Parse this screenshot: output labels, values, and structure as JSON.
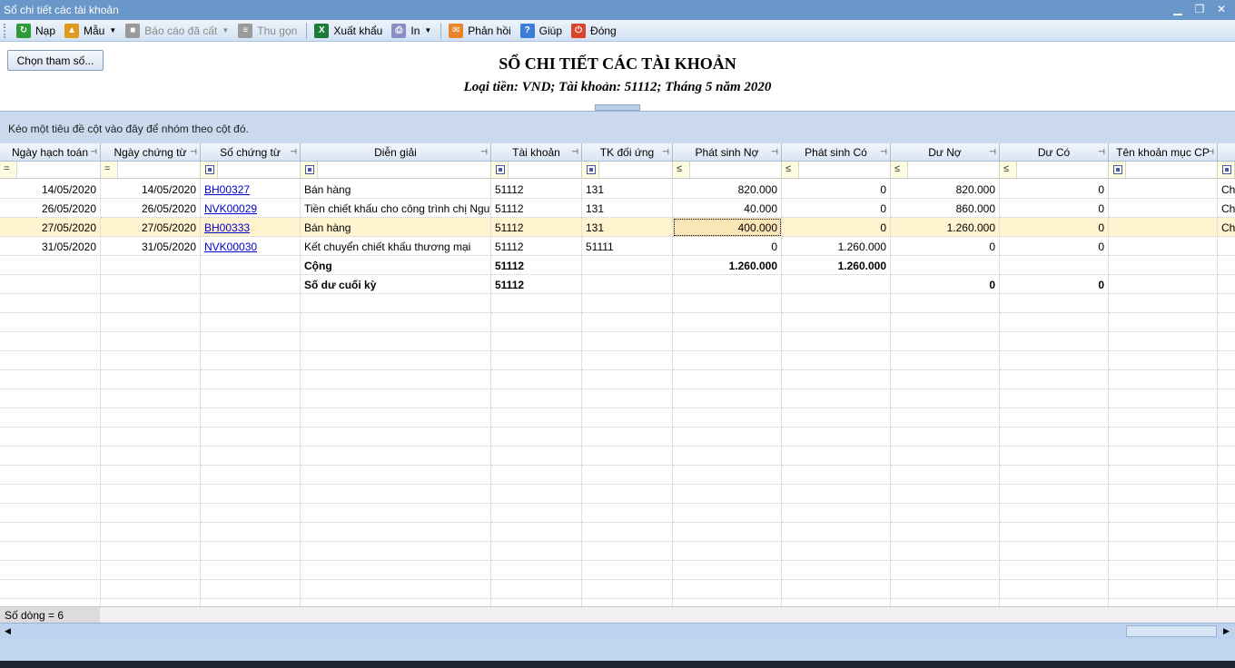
{
  "window": {
    "title": "Sổ chi tiết các tài khoản"
  },
  "toolbar": {
    "items": [
      {
        "label": "Nạp",
        "icon": "refresh-icon",
        "color": "#2e9b3a",
        "enabled": true
      },
      {
        "label": "Mẫu",
        "icon": "chart-icon",
        "color": "#e09a1f",
        "enabled": true,
        "dropdown": true
      },
      {
        "label": "Báo cáo đã cất",
        "icon": "save-icon",
        "color": "#9a9a9a",
        "enabled": false,
        "dropdown": true
      },
      {
        "label": "Thu gọn",
        "icon": "collapse-icon",
        "color": "#9a9a9a",
        "enabled": false
      },
      {
        "label": "Xuất khẩu",
        "icon": "excel-icon",
        "color": "#1e7a3a",
        "enabled": true
      },
      {
        "label": "In",
        "icon": "printer-icon",
        "color": "#8a8fc8",
        "enabled": true,
        "dropdown": true
      },
      {
        "label": "Phản hồi",
        "icon": "mail-icon",
        "color": "#e8842a",
        "enabled": true
      },
      {
        "label": "Giúp",
        "icon": "help-icon",
        "color": "#3b7dd8",
        "enabled": true
      },
      {
        "label": "Đóng",
        "icon": "power-icon",
        "color": "#d9452b",
        "enabled": true
      }
    ]
  },
  "params_button": "Chọn tham số...",
  "report": {
    "title": "SỔ CHI TIẾT CÁC TÀI KHOẢN",
    "subtitle": "Loại tiền: VND; Tài khoản: 51112; Tháng 5 năm 2020"
  },
  "group_hint": "Kéo một tiêu đề cột vào đây để nhóm theo cột đó.",
  "columns": [
    {
      "label": "Ngày hạch toán",
      "filter": "="
    },
    {
      "label": "Ngày chứng từ",
      "filter": "="
    },
    {
      "label": "Số chứng từ",
      "filter": "box"
    },
    {
      "label": "Diễn giải",
      "filter": "box"
    },
    {
      "label": "Tài khoản",
      "filter": "box"
    },
    {
      "label": "TK đối ứng",
      "filter": "box"
    },
    {
      "label": "Phát sinh Nợ",
      "filter": "≤"
    },
    {
      "label": "Phát sinh Có",
      "filter": "≤"
    },
    {
      "label": "Dư Nợ",
      "filter": "≤"
    },
    {
      "label": "Dư Có",
      "filter": "≤"
    },
    {
      "label": "Tên khoản mục CP",
      "filter": "box"
    },
    {
      "label": "",
      "filter": "box"
    }
  ],
  "rows": [
    [
      "14/05/2020",
      "14/05/2020",
      "BH00327",
      "Bán hàng",
      "51112",
      "131",
      "820.000",
      "0",
      "820.000",
      "0",
      "",
      "Ch"
    ],
    [
      "26/05/2020",
      "26/05/2020",
      "NVK00029",
      "Tiền chiết khấu cho công trình chị Nguy",
      "51112",
      "131",
      "40.000",
      "0",
      "860.000",
      "0",
      "",
      "Ch"
    ],
    [
      "27/05/2020",
      "27/05/2020",
      "BH00333",
      "Bán hàng",
      "51112",
      "131",
      "400.000",
      "0",
      "1.260.000",
      "0",
      "",
      "Ch"
    ],
    [
      "31/05/2020",
      "31/05/2020",
      "NVK00030",
      "Kết chuyển chiết khấu thương mại",
      "51112",
      "51111",
      "0",
      "1.260.000",
      "0",
      "0",
      "",
      ""
    ],
    [
      "",
      "",
      "",
      "Cộng",
      "51112",
      "",
      "1.260.000",
      "1.260.000",
      "",
      "",
      "",
      ""
    ],
    [
      "",
      "",
      "",
      "Số dư cuối kỳ",
      "51112",
      "",
      "",
      "",
      "0",
      "0",
      "",
      ""
    ]
  ],
  "status": {
    "row_count": "Số dòng = 6"
  }
}
